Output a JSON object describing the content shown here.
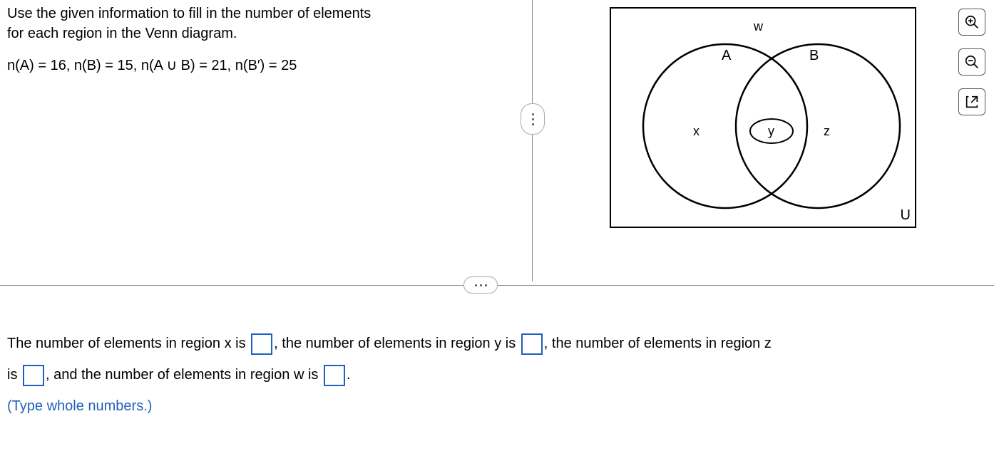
{
  "question": {
    "prompt_line1": "Use the given information to fill in the number of elements",
    "prompt_line2": "for each region in the Venn diagram.",
    "formula": "n(A) = 16, n(B) = 15, n(A ∪ B) = 21, n(B′) = 25"
  },
  "diagram": {
    "label_w": "w",
    "label_A": "A",
    "label_B": "B",
    "label_x": "x",
    "label_y": "y",
    "label_z": "z",
    "label_U": "U"
  },
  "answer": {
    "part1": "The number of elements in region x is ",
    "part2": ", the number of elements in region y is ",
    "part3": ", the number of elements in region z",
    "part4": "is ",
    "part5": ", and the number of elements in region w is ",
    "part6": ".",
    "hint": "(Type whole numbers.)"
  },
  "inputs": {
    "x": "",
    "y": "",
    "z": "",
    "w": ""
  },
  "tools": {
    "zoom_in": "zoom-in",
    "zoom_out": "zoom-out",
    "popout": "popout"
  }
}
